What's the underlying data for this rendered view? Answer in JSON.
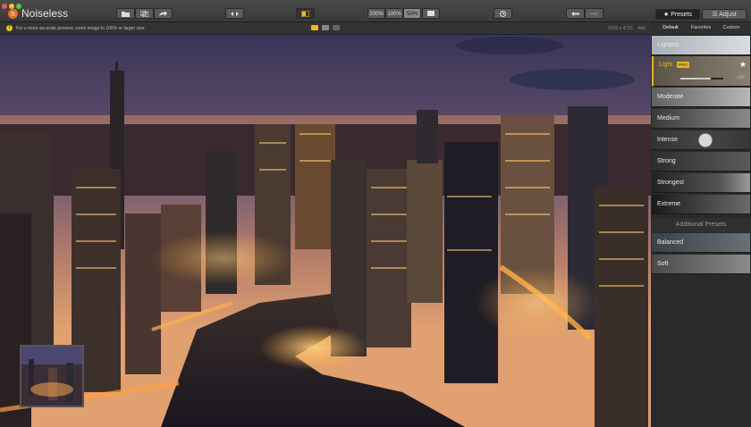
{
  "app": {
    "name": "Noiseless",
    "logo_letter": "n"
  },
  "toolbar": {
    "zoom_options": [
      "200%",
      "100%",
      "50%"
    ],
    "active_zoom": "50%",
    "presets_tab": "Presets",
    "adjust_tab": "Adjust"
  },
  "infobar": {
    "message": "For a more accurate preview, zoom image to 100% or larger size.",
    "dimensions": "5000 x 4716",
    "extra": "Add"
  },
  "preset_tabs": [
    "Default",
    "Favorites",
    "Custom"
  ],
  "presets": [
    {
      "label": "Lightest"
    },
    {
      "label": "Light",
      "badge": "PRO",
      "selected": true,
      "amount": "+37"
    },
    {
      "label": "Moderate"
    },
    {
      "label": "Medium"
    },
    {
      "label": "Intense"
    },
    {
      "label": "Strong"
    },
    {
      "label": "Strongest"
    },
    {
      "label": "Extreme"
    }
  ],
  "additional_presets": {
    "title": "Additional Presets",
    "items": [
      {
        "label": "Balanced"
      },
      {
        "label": "Soft"
      }
    ]
  },
  "colors": {
    "accent": "#e8b820",
    "logo": "#e07020",
    "background": "#2b2b2b"
  }
}
